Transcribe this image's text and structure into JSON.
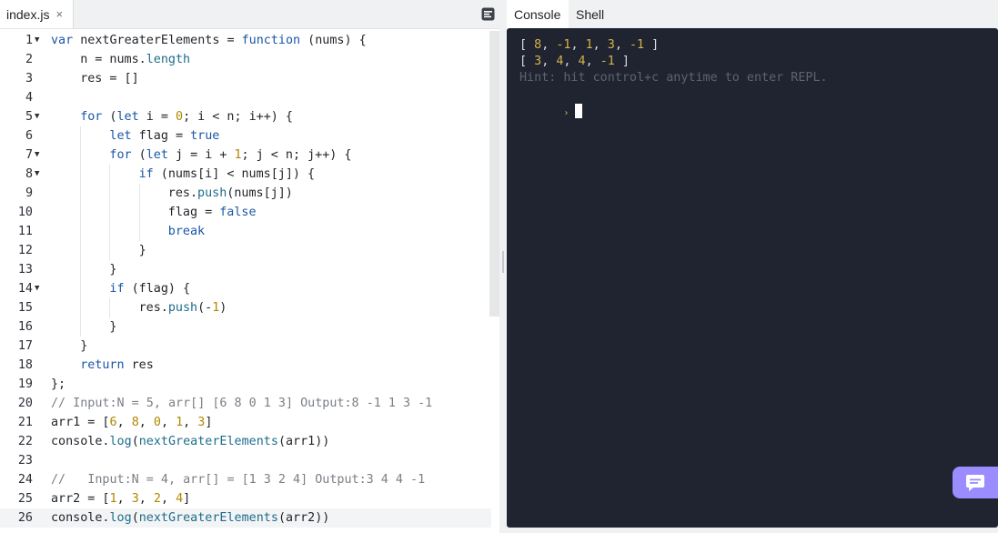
{
  "editor": {
    "file_tab": "index.js",
    "close_glyph": "×",
    "lines": [
      {
        "n": "1",
        "fold": true,
        "indent": 0,
        "tokens": [
          [
            "kw",
            "var"
          ],
          [
            "p",
            " nextGreaterElements = "
          ],
          [
            "kw",
            "function"
          ],
          [
            "p",
            " (nums) {"
          ]
        ]
      },
      {
        "n": "2",
        "fold": false,
        "indent": 1,
        "tokens": [
          [
            "p",
            "n = nums."
          ],
          [
            "pp",
            "length"
          ]
        ]
      },
      {
        "n": "3",
        "fold": false,
        "indent": 1,
        "tokens": [
          [
            "p",
            "res = []"
          ]
        ]
      },
      {
        "n": "4",
        "fold": false,
        "indent": 0,
        "tokens": []
      },
      {
        "n": "5",
        "fold": true,
        "indent": 1,
        "tokens": [
          [
            "kw",
            "for"
          ],
          [
            "p",
            " ("
          ],
          [
            "kw",
            "let"
          ],
          [
            "p",
            " i = "
          ],
          [
            "nm",
            "0"
          ],
          [
            "p",
            "; i < n; i++) {"
          ]
        ]
      },
      {
        "n": "6",
        "fold": false,
        "indent": 2,
        "tokens": [
          [
            "kw",
            "let"
          ],
          [
            "p",
            " flag = "
          ],
          [
            "kw",
            "true"
          ]
        ]
      },
      {
        "n": "7",
        "fold": true,
        "indent": 2,
        "tokens": [
          [
            "kw",
            "for"
          ],
          [
            "p",
            " ("
          ],
          [
            "kw",
            "let"
          ],
          [
            "p",
            " j = i + "
          ],
          [
            "nm",
            "1"
          ],
          [
            "p",
            "; j < n; j++) {"
          ]
        ]
      },
      {
        "n": "8",
        "fold": true,
        "indent": 3,
        "tokens": [
          [
            "kw",
            "if"
          ],
          [
            "p",
            " (nums[i] < nums[j]) {"
          ]
        ]
      },
      {
        "n": "9",
        "fold": false,
        "indent": 4,
        "tokens": [
          [
            "p",
            "res."
          ],
          [
            "fn",
            "push"
          ],
          [
            "p",
            "(nums[j])"
          ]
        ]
      },
      {
        "n": "10",
        "fold": false,
        "indent": 4,
        "tokens": [
          [
            "p",
            "flag = "
          ],
          [
            "kw",
            "false"
          ]
        ]
      },
      {
        "n": "11",
        "fold": false,
        "indent": 4,
        "tokens": [
          [
            "kw",
            "break"
          ]
        ]
      },
      {
        "n": "12",
        "fold": false,
        "indent": 3,
        "tokens": [
          [
            "p",
            "}"
          ]
        ]
      },
      {
        "n": "13",
        "fold": false,
        "indent": 2,
        "tokens": [
          [
            "p",
            "}"
          ]
        ]
      },
      {
        "n": "14",
        "fold": true,
        "indent": 2,
        "tokens": [
          [
            "kw",
            "if"
          ],
          [
            "p",
            " (flag) {"
          ]
        ]
      },
      {
        "n": "15",
        "fold": false,
        "indent": 3,
        "tokens": [
          [
            "p",
            "res."
          ],
          [
            "fn",
            "push"
          ],
          [
            "p",
            "(-"
          ],
          [
            "nm",
            "1"
          ],
          [
            "p",
            ")"
          ]
        ]
      },
      {
        "n": "16",
        "fold": false,
        "indent": 2,
        "tokens": [
          [
            "p",
            "}"
          ]
        ]
      },
      {
        "n": "17",
        "fold": false,
        "indent": 1,
        "tokens": [
          [
            "p",
            "}"
          ]
        ]
      },
      {
        "n": "18",
        "fold": false,
        "indent": 1,
        "tokens": [
          [
            "kw",
            "return"
          ],
          [
            "p",
            " res"
          ]
        ]
      },
      {
        "n": "19",
        "fold": false,
        "indent": 0,
        "tokens": [
          [
            "p",
            "};"
          ]
        ]
      },
      {
        "n": "20",
        "fold": false,
        "indent": 0,
        "tokens": [
          [
            "cm",
            "// Input:N = 5, arr[] [6 8 0 1 3] Output:8 -1 1 3 -1"
          ]
        ]
      },
      {
        "n": "21",
        "fold": false,
        "indent": 0,
        "tokens": [
          [
            "p",
            "arr1 = ["
          ],
          [
            "nm",
            "6"
          ],
          [
            "p",
            ", "
          ],
          [
            "nm",
            "8"
          ],
          [
            "p",
            ", "
          ],
          [
            "nm",
            "0"
          ],
          [
            "p",
            ", "
          ],
          [
            "nm",
            "1"
          ],
          [
            "p",
            ", "
          ],
          [
            "nm",
            "3"
          ],
          [
            "p",
            "]"
          ]
        ]
      },
      {
        "n": "22",
        "fold": false,
        "indent": 0,
        "tokens": [
          [
            "p",
            "console."
          ],
          [
            "fn",
            "log"
          ],
          [
            "p",
            "("
          ],
          [
            "fn",
            "nextGreaterElements"
          ],
          [
            "p",
            "(arr1))"
          ]
        ]
      },
      {
        "n": "23",
        "fold": false,
        "indent": 0,
        "tokens": []
      },
      {
        "n": "24",
        "fold": false,
        "indent": 0,
        "tokens": [
          [
            "cm",
            "//   Input:N = 4, arr[] = [1 3 2 4] Output:3 4 4 -1"
          ]
        ]
      },
      {
        "n": "25",
        "fold": false,
        "indent": 0,
        "tokens": [
          [
            "p",
            "arr2 = ["
          ],
          [
            "nm",
            "1"
          ],
          [
            "p",
            ", "
          ],
          [
            "nm",
            "3"
          ],
          [
            "p",
            ", "
          ],
          [
            "nm",
            "2"
          ],
          [
            "p",
            ", "
          ],
          [
            "nm",
            "4"
          ],
          [
            "p",
            "]"
          ]
        ]
      },
      {
        "n": "26",
        "fold": false,
        "indent": 0,
        "tokens": [
          [
            "p",
            "console."
          ],
          [
            "fn",
            "log"
          ],
          [
            "p",
            "("
          ],
          [
            "fn",
            "nextGreaterElements"
          ],
          [
            "p",
            "(arr2))"
          ]
        ]
      }
    ],
    "active_line": "26"
  },
  "console": {
    "tabs": [
      {
        "label": "Console",
        "active": true
      },
      {
        "label": "Shell",
        "active": false
      }
    ],
    "output": [
      [
        "8",
        "-1",
        "1",
        "3",
        "-1"
      ],
      [
        "3",
        "4",
        "4",
        "-1"
      ]
    ],
    "hint": "Hint: hit control+c anytime to enter REPL.",
    "prompt": "›"
  },
  "icons": {
    "format": "format-icon",
    "chat": "chat-icon",
    "fold": "fold-arrow-icon"
  },
  "colors": {
    "keyword": "#1a56a6",
    "number": "#b08800",
    "console_bg": "#1f2430",
    "chat_button": "#9b8cff"
  }
}
